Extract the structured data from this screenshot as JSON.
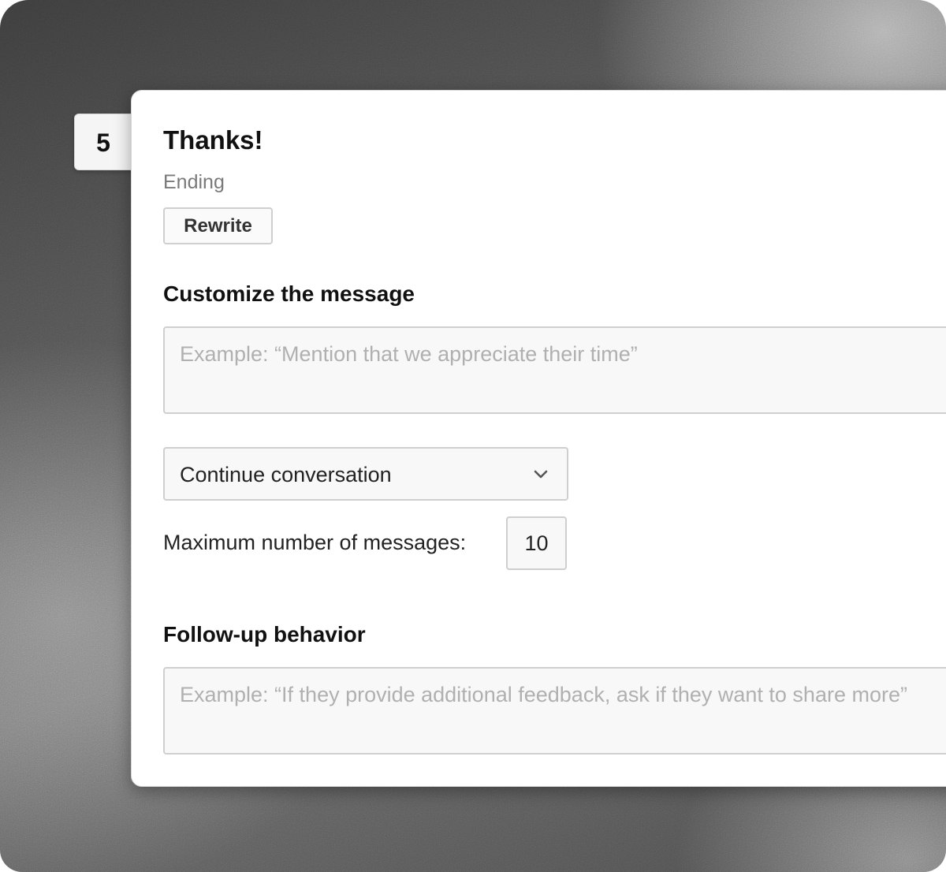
{
  "step": {
    "number": "5"
  },
  "card": {
    "title": "Thanks!",
    "subtitle": "Ending",
    "rewrite_label": "Rewrite"
  },
  "customize": {
    "label": "Customize the message",
    "placeholder": "Example: “Mention that we appreciate their time”",
    "value": ""
  },
  "ending_mode": {
    "selected": "Continue conversation",
    "icon": "chevron-down-icon"
  },
  "max_messages": {
    "label": "Maximum number of messages:",
    "value": "10"
  },
  "follow_up": {
    "label": "Follow-up behavior",
    "placeholder": "Example: “If they provide additional feedback, ask if they want to share more”",
    "value": ""
  },
  "colors": {
    "card_background": "#ffffff",
    "field_background": "#f8f8f8",
    "field_border": "#cfcfcf",
    "placeholder_text": "#b0b0b0",
    "muted_text": "#7a7a7a"
  }
}
